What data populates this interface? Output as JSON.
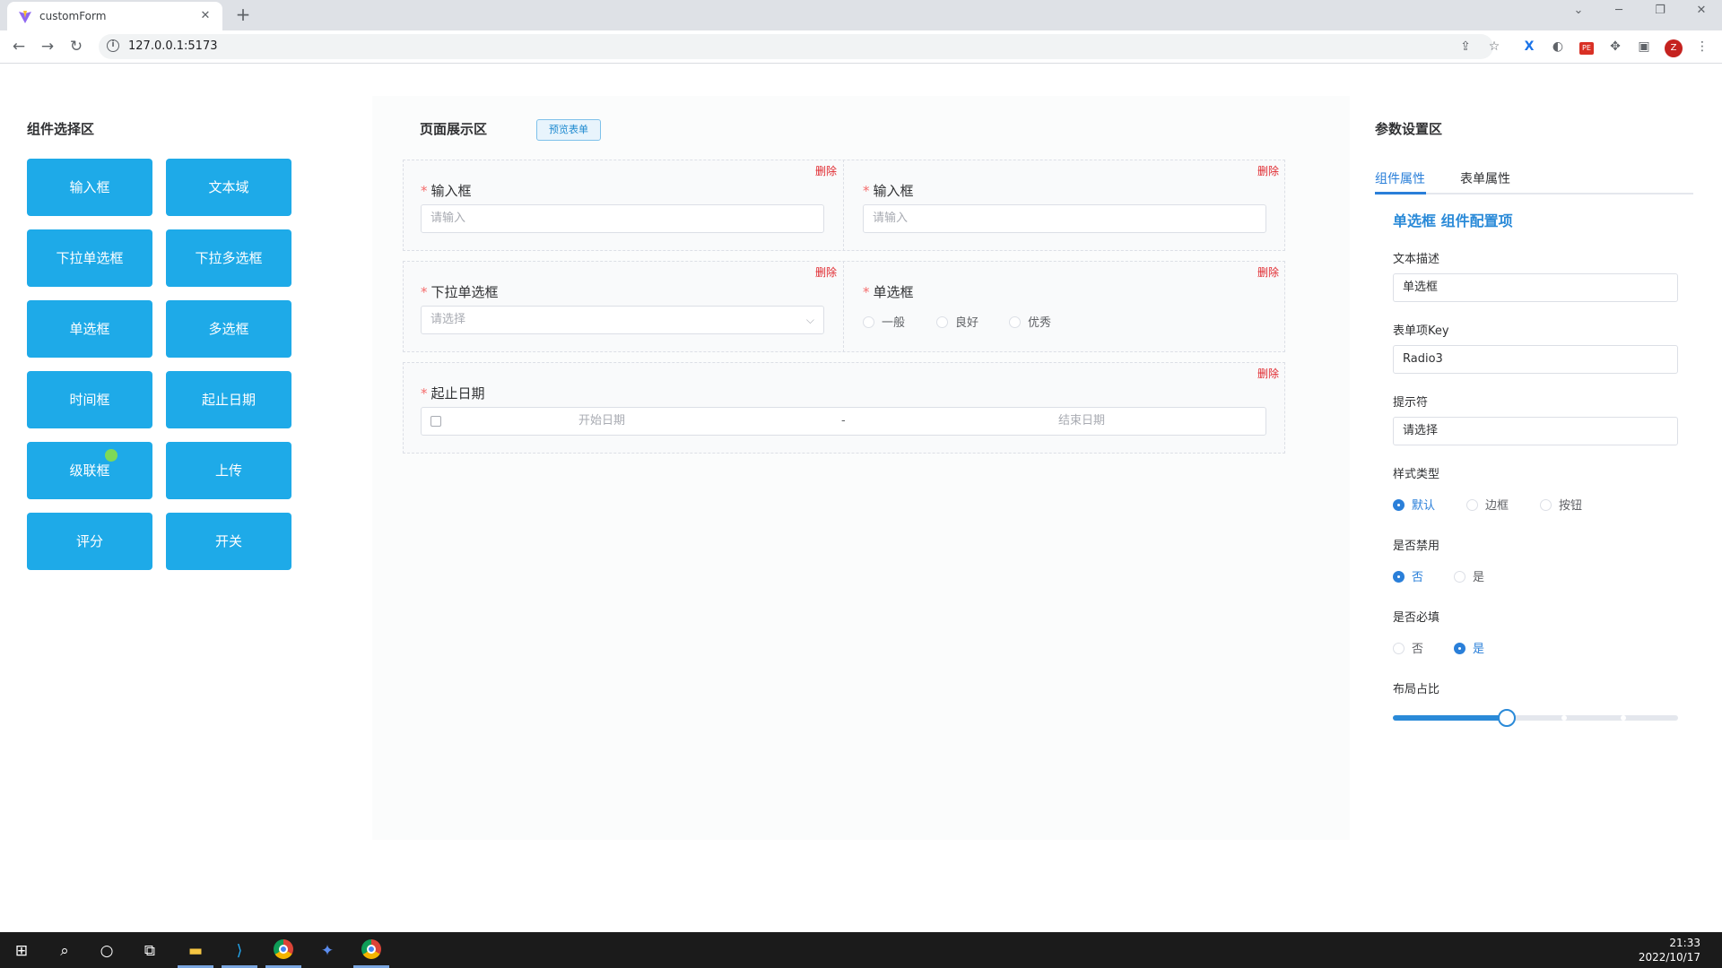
{
  "browser": {
    "tab_title": "customForm",
    "url": "127.0.0.1:5173",
    "accent_profile": "#c5221f"
  },
  "palette": {
    "component_button": "#1eaae8",
    "required_star": "#f56c6c",
    "delete_text": "#e0282e",
    "active_blue": "#2a7fd9"
  },
  "left_panel": {
    "title": "组件选择区",
    "components": [
      "输入框",
      "文本域",
      "下拉单选框",
      "下拉多选框",
      "单选框",
      "多选框",
      "时间框",
      "起止日期",
      "级联框",
      "上传",
      "评分",
      "开关"
    ]
  },
  "center": {
    "title": "页面展示区",
    "preview_button": "预览表单",
    "delete_label": "删除",
    "fields": {
      "input1": {
        "label": "输入框",
        "placeholder": "请输入"
      },
      "input2": {
        "label": "输入框",
        "placeholder": "请输入"
      },
      "select": {
        "label": "下拉单选框",
        "placeholder": "请选择"
      },
      "radio": {
        "label": "单选框",
        "options": [
          "一般",
          "良好",
          "优秀"
        ]
      },
      "daterange": {
        "label": "起止日期",
        "start_placeholder": "开始日期",
        "separator": "-",
        "end_placeholder": "结束日期"
      }
    }
  },
  "right_panel": {
    "title": "参数设置区",
    "tabs": [
      "组件属性",
      "表单属性"
    ],
    "active_tab": "组件属性",
    "config_title": "单选框 组件配置项",
    "text_desc_label": "文本描述",
    "text_desc_value": "单选框",
    "key_label": "表单项Key",
    "key_value": "Radio3",
    "placeholder_label": "提示符",
    "placeholder_value": "请选择",
    "style_label": "样式类型",
    "style_options": [
      "默认",
      "边框",
      "按钮"
    ],
    "style_selected": "默认",
    "disabled_label": "是否禁用",
    "disabled_options": [
      "否",
      "是"
    ],
    "disabled_selected": "否",
    "required_label": "是否必填",
    "required_options": [
      "否",
      "是"
    ],
    "required_selected": "是",
    "layout_label": "布局占比",
    "layout_value_fraction": 0.4
  },
  "taskbar": {
    "time": "21:33",
    "date": "2022/10/17"
  }
}
